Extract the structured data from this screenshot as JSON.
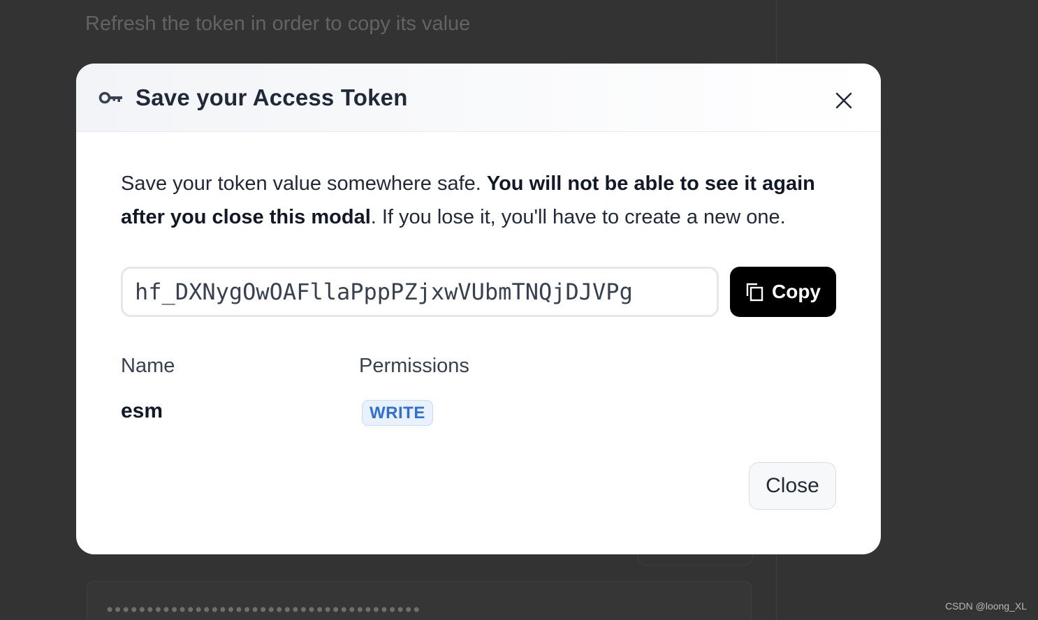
{
  "background": {
    "refresh_hint": "Refresh the token in order to copy its value",
    "masked_token": "•••••••••••••••••••••••••••••••••••••••"
  },
  "modal": {
    "title": "Save your Access Token",
    "icons": {
      "header": "key-icon",
      "close": "close-icon",
      "copy": "copy-icon"
    },
    "description": {
      "lead": "Save your token value somewhere safe. ",
      "emphasis": "You will not be able to see it again after you close this modal",
      "tail": ". If you lose it, you'll have to create a new one."
    },
    "token_value": "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",
    "copy_label": "Copy",
    "table": {
      "headers": {
        "name": "Name",
        "permissions": "Permissions"
      },
      "row": {
        "name": "esm",
        "permission": "WRITE"
      }
    },
    "close_label": "Close"
  },
  "watermark": "CSDN @loong_XL",
  "colors": {
    "overlay": "#333333",
    "badge_text": "#2f6fd6",
    "badge_bg": "#e9f1fe",
    "copy_button_bg": "#000000"
  }
}
